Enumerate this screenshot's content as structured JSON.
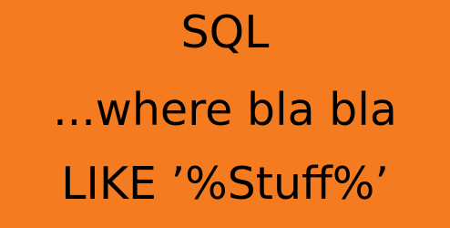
{
  "slide": {
    "background_color": "#f47b20",
    "text_color": "#000000",
    "lines": [
      "SQL",
      "...where bla bla",
      "LIKE ’%Stuff%’"
    ]
  }
}
